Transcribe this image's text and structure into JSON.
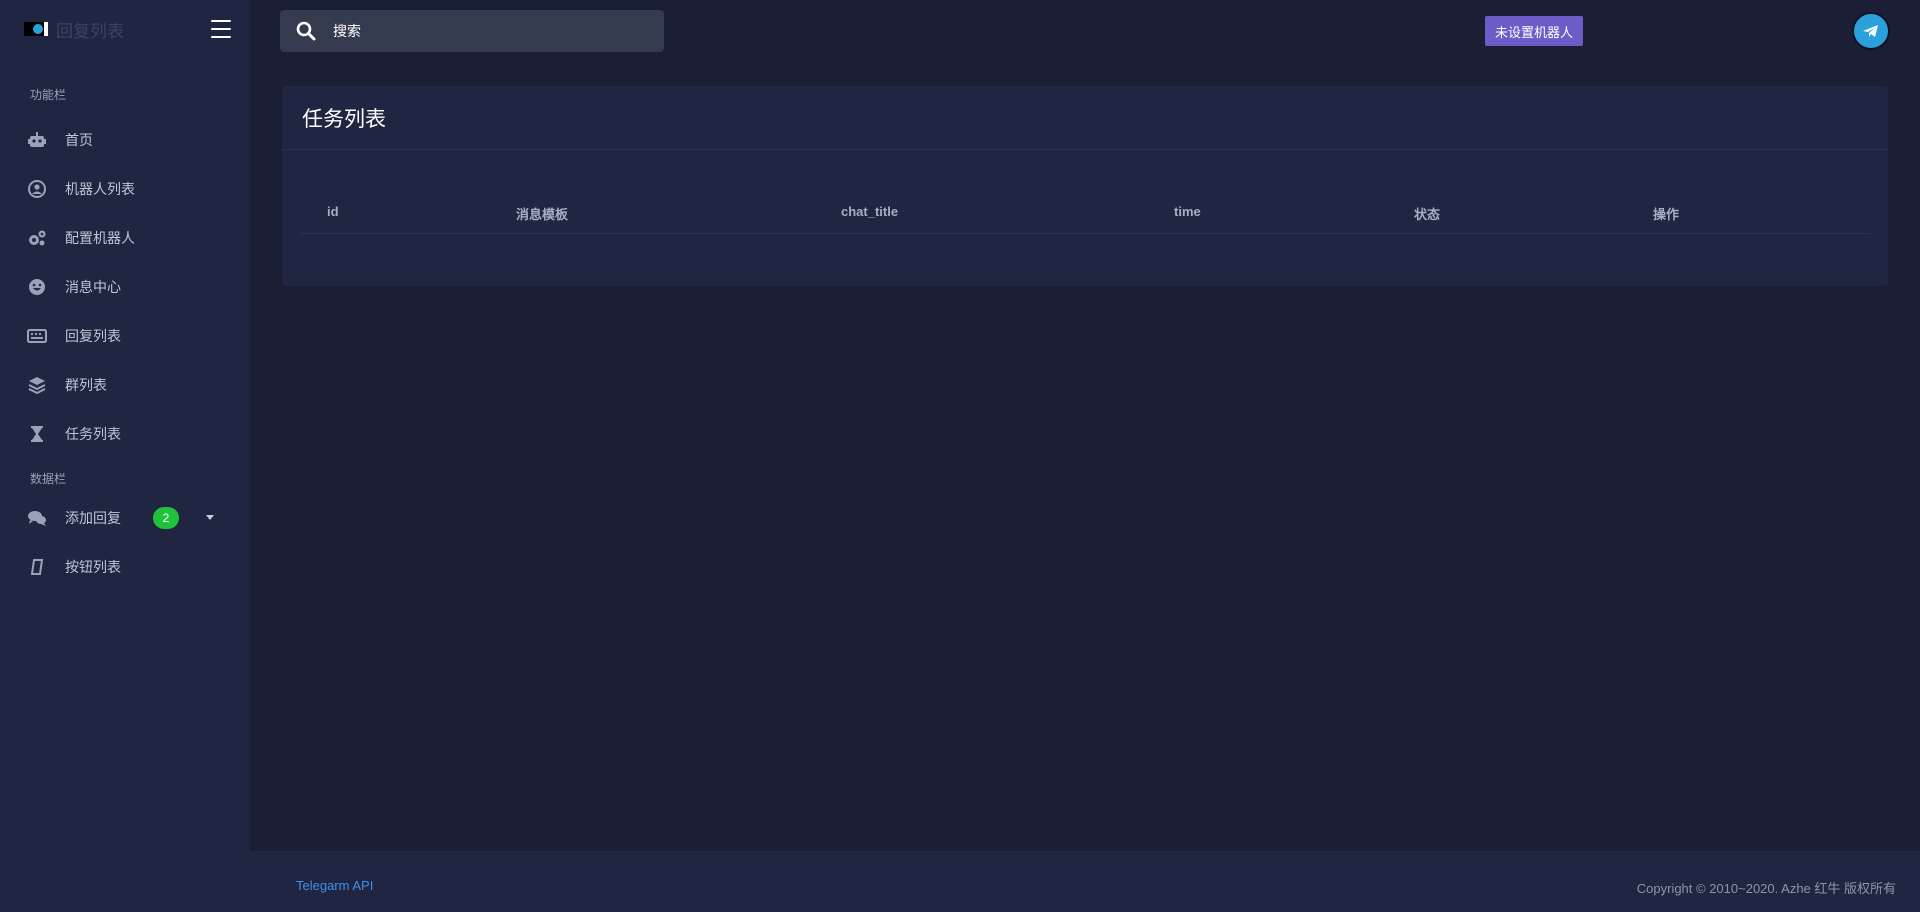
{
  "brand": {
    "title": "回复列表"
  },
  "sidebar": {
    "sections": [
      {
        "label": "功能栏",
        "items": [
          {
            "label": "首页",
            "icon": "robot-icon"
          },
          {
            "label": "机器人列表",
            "icon": "user-circle-icon"
          },
          {
            "label": "配置机器人",
            "icon": "gears-icon"
          },
          {
            "label": "消息中心",
            "icon": "smile-icon"
          },
          {
            "label": "回复列表",
            "icon": "keyboard-icon"
          },
          {
            "label": "群列表",
            "icon": "layers-icon"
          },
          {
            "label": "任务列表",
            "icon": "hourglass-icon"
          }
        ]
      },
      {
        "label": "数据栏",
        "items": [
          {
            "label": "添加回复",
            "icon": "comments-icon",
            "badge": "2"
          },
          {
            "label": "按钮列表",
            "icon": "sticky-note-icon"
          }
        ]
      }
    ]
  },
  "search": {
    "label": "搜索"
  },
  "topbar": {
    "robot_status": "未设置机器人"
  },
  "card": {
    "title": "任务列表",
    "columns": [
      "id",
      "消息模板",
      "chat_title",
      "time",
      "状态",
      "操作"
    ]
  },
  "footer": {
    "link": "Telegarm API",
    "copyright": "Copyright © 2010~2020. Azhe 红牛 版权所有"
  },
  "colors": {
    "background": "#1a1f36",
    "panel": "#202641",
    "badge": "#1fc23a",
    "robot_status": "#6c5cc8",
    "link": "#3f8ee8"
  }
}
